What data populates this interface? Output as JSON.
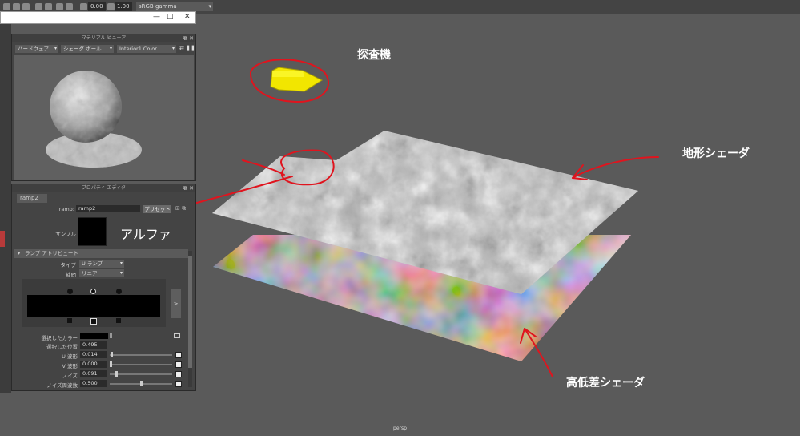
{
  "toolbar": {
    "value_a": "0.00",
    "value_b": "1.00",
    "color_space": "sRGB gamma"
  },
  "viewport": {
    "camera_label": "persp"
  },
  "material_viewer": {
    "title": "マテリアル ビューア",
    "renderer": "ハードウェア",
    "shader_ball": "シェーダ ボール",
    "material": "Interior1 Color"
  },
  "property_editor": {
    "title": "プロパティ エディタ",
    "tab": "ramp2",
    "node_label": "ramp:",
    "node_name": "ramp2",
    "preset_button": "プリセット",
    "sample_label": "サンプル",
    "section_title": "ランプ アトリビュート",
    "type_label": "タイプ",
    "type_value": "U ランプ",
    "interp_label": "補間",
    "interp_value": "リニア",
    "expand_glyph": ">",
    "selected_color_label": "選択したカラー",
    "selected_pos_label": "選択した位置",
    "selected_pos_value": "0.495",
    "u_wave_label": "U 波形",
    "u_wave_value": "0.014",
    "v_wave_label": "V 波形",
    "v_wave_value": "0.000",
    "noise_label": "ノイズ",
    "noise_value": "0.091",
    "noise_freq_label": "ノイズ周波数",
    "noise_freq_value": "0.500"
  },
  "annotations": {
    "probe": "探査機",
    "terrain_shader": "地形シェーダ",
    "height_shader": "高低差シェーダ",
    "alpha": "アルファ"
  },
  "colors": {
    "annotation_red": "#e0141e",
    "probe_yellow": "#f2e600",
    "panel_bg": "#444444"
  }
}
